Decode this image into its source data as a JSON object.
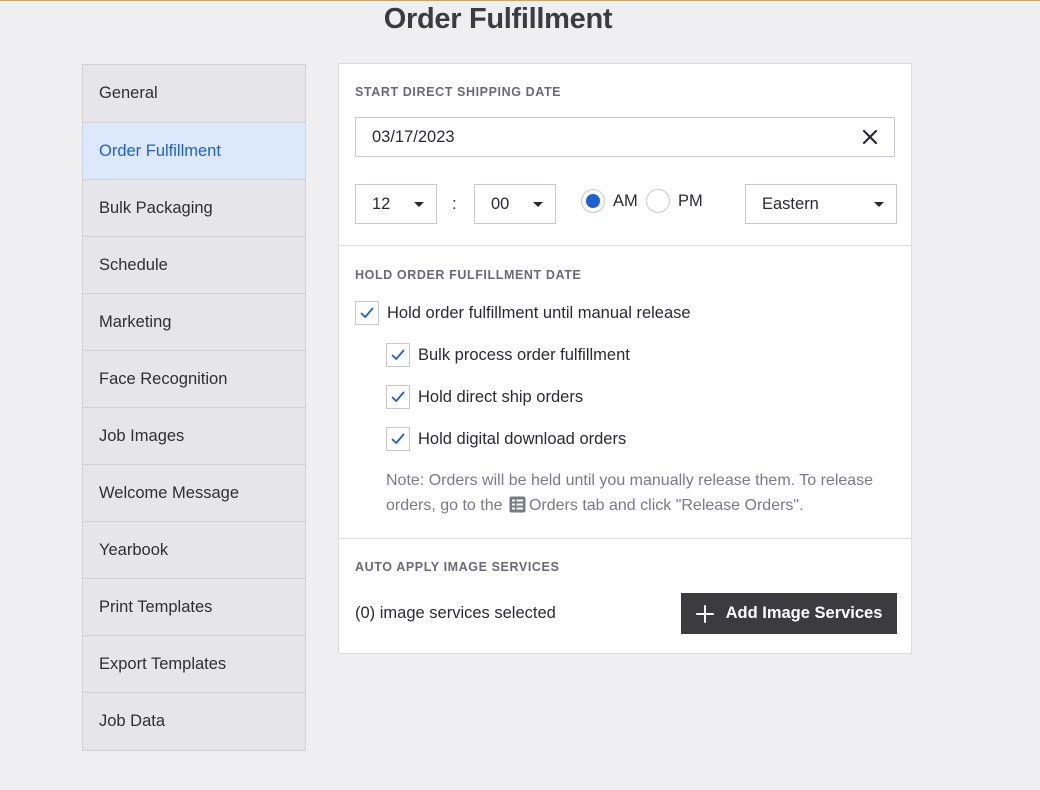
{
  "page": {
    "title": "Order Fulfillment"
  },
  "sidebar": {
    "items": [
      {
        "label": "General",
        "active": false
      },
      {
        "label": "Order Fulfillment",
        "active": true
      },
      {
        "label": "Bulk Packaging",
        "active": false
      },
      {
        "label": "Schedule",
        "active": false
      },
      {
        "label": "Marketing",
        "active": false
      },
      {
        "label": "Face Recognition",
        "active": false
      },
      {
        "label": "Job Images",
        "active": false
      },
      {
        "label": "Welcome Message",
        "active": false
      },
      {
        "label": "Yearbook",
        "active": false
      },
      {
        "label": "Print Templates",
        "active": false
      },
      {
        "label": "Export Templates",
        "active": false
      },
      {
        "label": "Job Data",
        "active": false
      }
    ]
  },
  "shipping": {
    "section_label": "START DIRECT SHIPPING DATE",
    "date_value": "03/17/2023",
    "clear_icon": "close-icon",
    "hour_value": "12",
    "separator": ":",
    "minute_value": "00",
    "am_label": "AM",
    "pm_label": "PM",
    "selected_period": "AM",
    "timezone_value": "Eastern"
  },
  "hold": {
    "section_label": "HOLD ORDER FULFILLMENT DATE",
    "manual_release_label": "Hold order fulfillment until manual release",
    "manual_release_checked": true,
    "bulk_process_label": "Bulk process order fulfillment",
    "bulk_process_checked": true,
    "direct_ship_label": "Hold direct ship orders",
    "direct_ship_checked": true,
    "digital_download_label": "Hold digital download orders",
    "digital_download_checked": true,
    "note_before": "Note: Orders will be held until you manually release them. To release orders, go to the",
    "note_after": "Orders tab and click \"Release Orders\".",
    "note_icon": "orders-list-icon"
  },
  "services": {
    "section_label": "AUTO APPLY IMAGE SERVICES",
    "count_text": "(0) image services selected",
    "add_button_label": "Add Image Services",
    "add_icon": "plus-icon"
  },
  "colors": {
    "accent": "#1f5fd6",
    "active_bg": "#dce8fb",
    "button_bg": "#3b3b40",
    "page_bg": "#efeff1"
  }
}
